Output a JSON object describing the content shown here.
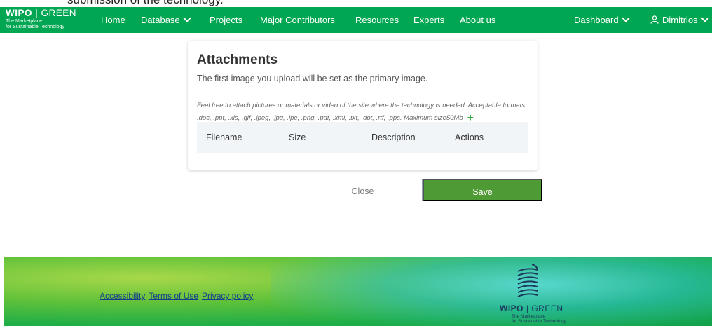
{
  "doc": {
    "clipped_text": "submission of the technology."
  },
  "navbar": {
    "brand": {
      "wipo": "WIPO",
      "separator": "|",
      "green": "GREEN",
      "sub1": "The Marketplace",
      "sub2": "for Sustainable Technology"
    },
    "items": [
      {
        "label": "Home"
      },
      {
        "label": "Database"
      },
      {
        "label": "Projects"
      },
      {
        "label": "Major Contributors"
      },
      {
        "label": "Resources"
      },
      {
        "label": "Experts"
      },
      {
        "label": "About us"
      }
    ],
    "dashboard": "Dashboard",
    "user": "Dimitrios"
  },
  "attachments": {
    "title": "Attachments",
    "subtitle": "The first image you upload will be set as the primary image.",
    "note": "Feel free to attach pictures or materials or video of the site where the technology is needed. Acceptable formats: .doc, .ppt, .xls, .gif, .jpeg, .jpg, .jpe, .png, .pdf, .xml, .txt, .dot, .rtf, .pps. Maximum size50Mb",
    "columns": [
      "Filename",
      "Size",
      "Description",
      "Actions"
    ]
  },
  "buttons": {
    "close": "Close",
    "save": "Save"
  },
  "footer": {
    "links": [
      "Accessibility",
      "Terms of Use",
      "Privacy policy"
    ],
    "logo": {
      "wipo": "WIPO",
      "separator": "|",
      "green": "GREEN",
      "sub1": "The Marketplace",
      "sub2": "for Sustainable Technology"
    }
  },
  "colors": {
    "brand_green": "#00a651",
    "save_green": "#4e9a34",
    "link_blue": "#173e8c"
  }
}
